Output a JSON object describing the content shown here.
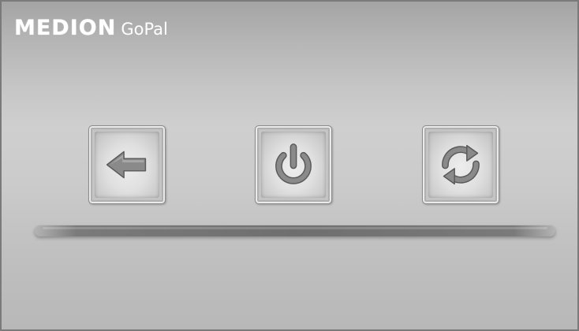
{
  "brand": {
    "name": "MEDION",
    "product": "GoPal"
  },
  "buttons": [
    {
      "id": "back",
      "icon": "back-arrow-icon"
    },
    {
      "id": "power",
      "icon": "power-icon"
    },
    {
      "id": "reset",
      "icon": "refresh-icon"
    }
  ],
  "colors": {
    "background": "#c6c6c6",
    "icon": "#8a8a8a",
    "divider": "#727272",
    "logo_text": "#ffffff"
  }
}
